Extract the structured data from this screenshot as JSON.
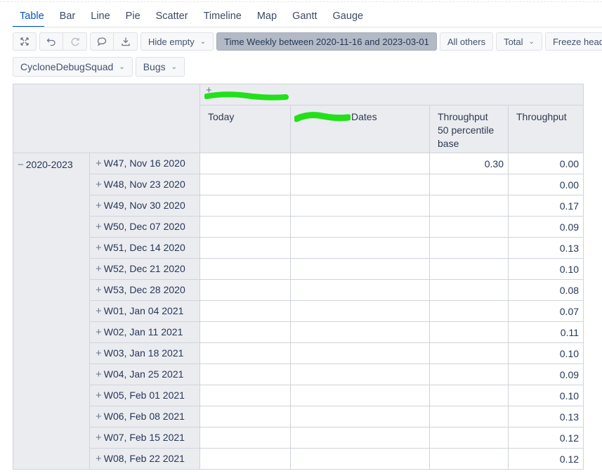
{
  "tabs": [
    {
      "label": "Table",
      "active": true
    },
    {
      "label": "Bar"
    },
    {
      "label": "Line"
    },
    {
      "label": "Pie"
    },
    {
      "label": "Scatter"
    },
    {
      "label": "Timeline"
    },
    {
      "label": "Map"
    },
    {
      "label": "Gantt"
    },
    {
      "label": "Gauge"
    }
  ],
  "toolbar": {
    "icons": [
      "expand-icon",
      "undo-icon",
      "redo-icon",
      "comment-icon",
      "export-icon"
    ],
    "hide_empty": "Hide empty",
    "time_filter": "Time Weekly between 2020-11-16 and 2023-03-01",
    "all_others": "All others",
    "total": "Total",
    "freeze_header": "Freeze header"
  },
  "filters": {
    "squad": "CycloneDebugSquad",
    "issue_type": "Bugs"
  },
  "table": {
    "group_header": "+",
    "columns": {
      "today": "Today",
      "dates": "Dates",
      "throughput_50": "Throughput 50 percentile base",
      "throughput": "Throughput"
    },
    "year_label": "2020-2023",
    "year_toggle": "−",
    "row_toggle": "+",
    "rows": [
      {
        "week": "W47, Nov 16 2020",
        "today": "",
        "dates": "",
        "throughput_50": "0.30",
        "throughput": "0.00"
      },
      {
        "week": "W48, Nov 23 2020",
        "today": "",
        "dates": "",
        "throughput_50": "",
        "throughput": "0.00"
      },
      {
        "week": "W49, Nov 30 2020",
        "today": "",
        "dates": "",
        "throughput_50": "",
        "throughput": "0.17"
      },
      {
        "week": "W50, Dec 07 2020",
        "today": "",
        "dates": "",
        "throughput_50": "",
        "throughput": "0.09"
      },
      {
        "week": "W51, Dec 14 2020",
        "today": "",
        "dates": "",
        "throughput_50": "",
        "throughput": "0.13"
      },
      {
        "week": "W52, Dec 21 2020",
        "today": "",
        "dates": "",
        "throughput_50": "",
        "throughput": "0.10"
      },
      {
        "week": "W53, Dec 28 2020",
        "today": "",
        "dates": "",
        "throughput_50": "",
        "throughput": "0.08"
      },
      {
        "week": "W01, Jan 04 2021",
        "today": "",
        "dates": "",
        "throughput_50": "",
        "throughput": "0.07"
      },
      {
        "week": "W02, Jan 11 2021",
        "today": "",
        "dates": "",
        "throughput_50": "",
        "throughput": "0.11"
      },
      {
        "week": "W03, Jan 18 2021",
        "today": "",
        "dates": "",
        "throughput_50": "",
        "throughput": "0.10"
      },
      {
        "week": "W04, Jan 25 2021",
        "today": "",
        "dates": "",
        "throughput_50": "",
        "throughput": "0.09"
      },
      {
        "week": "W05, Feb 01 2021",
        "today": "",
        "dates": "",
        "throughput_50": "",
        "throughput": "0.10"
      },
      {
        "week": "W06, Feb 08 2021",
        "today": "",
        "dates": "",
        "throughput_50": "",
        "throughput": "0.13"
      },
      {
        "week": "W07, Feb 15 2021",
        "today": "",
        "dates": "",
        "throughput_50": "",
        "throughput": "0.12"
      },
      {
        "week": "W08, Feb 22 2021",
        "today": "",
        "dates": "",
        "throughput_50": "",
        "throughput": "0.12"
      }
    ]
  },
  "colors": {
    "accent": "#0052cc",
    "redaction": "#22e01a",
    "header_bg": "#ebecf0",
    "active_button": "#b3bac5"
  }
}
